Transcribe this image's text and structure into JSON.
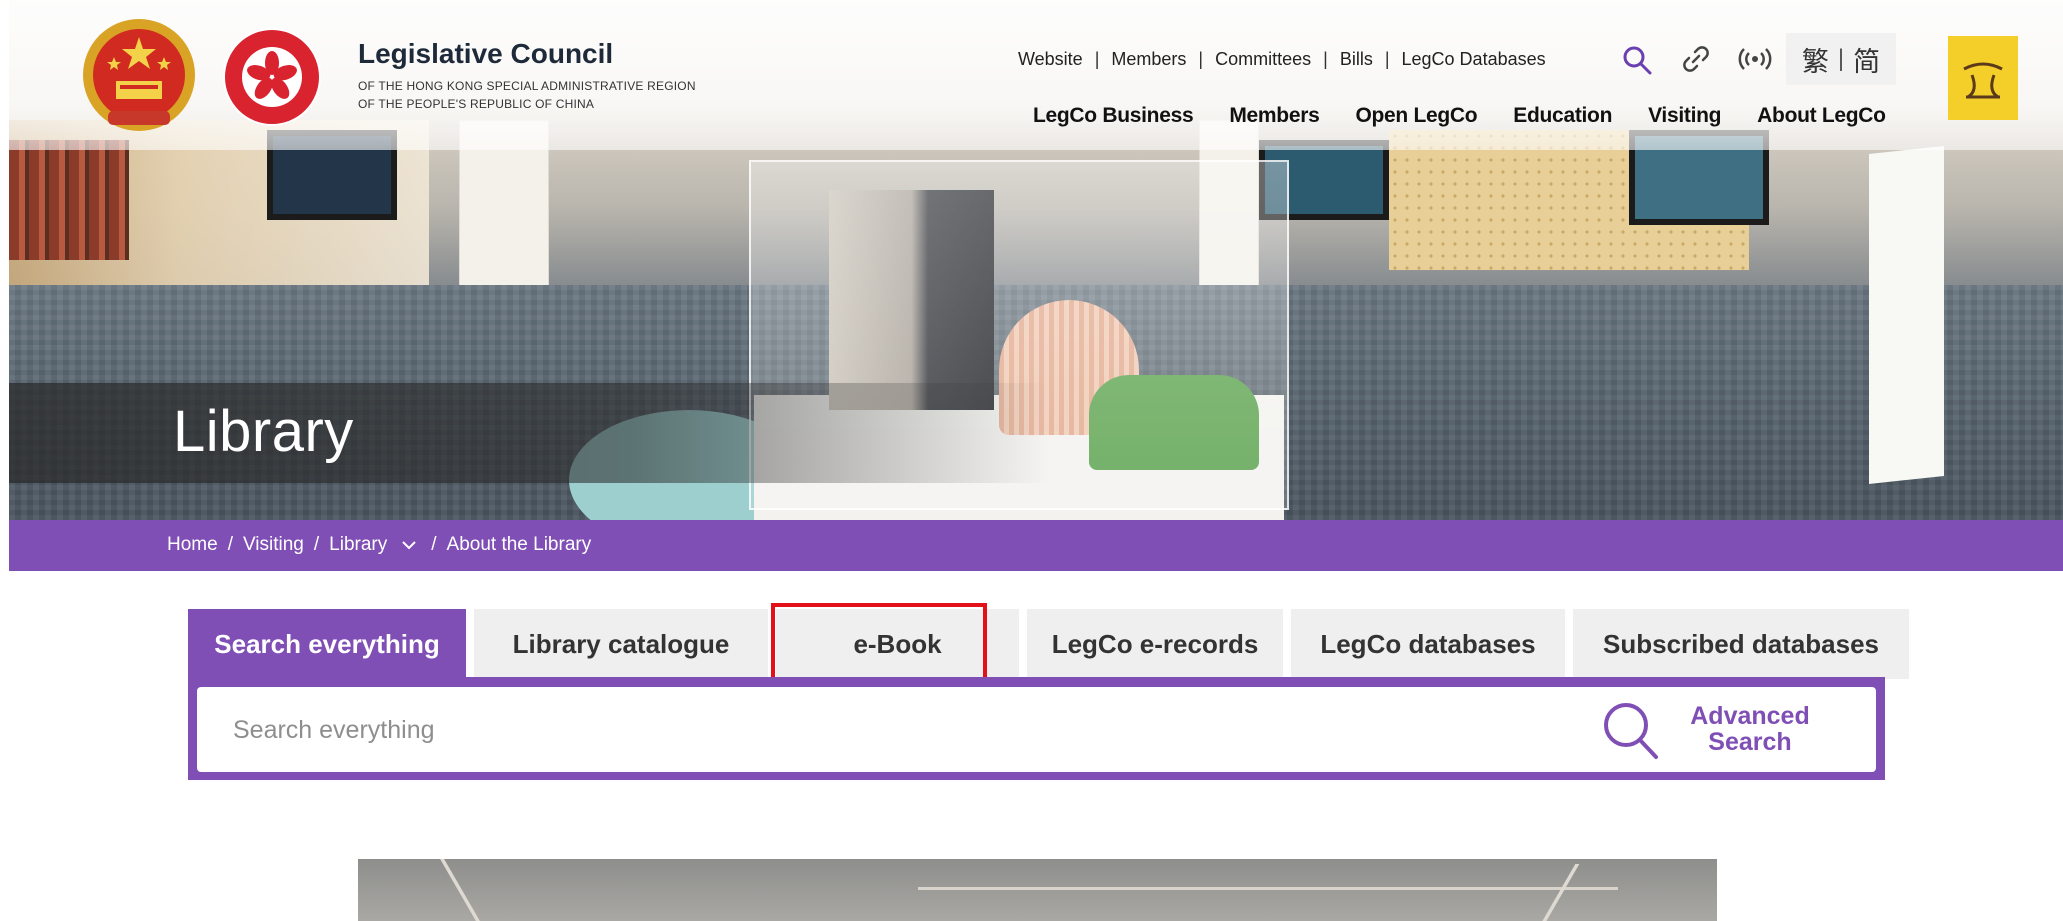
{
  "header": {
    "org_name": "Legislative Council",
    "org_sub1": "OF THE HONG KONG SPECIAL ADMINISTRATIVE REGION",
    "org_sub2": "OF THE PEOPLE'S REPUBLIC OF CHINA",
    "top_links": [
      "Website",
      "Members",
      "Committees",
      "Bills",
      "LegCo Databases"
    ],
    "lang_traditional": "繁",
    "lang_simplified": "简",
    "main_nav": [
      "LegCo Business",
      "Members",
      "Open LegCo",
      "Education",
      "Visiting",
      "About LegCo"
    ]
  },
  "hero": {
    "title": "Library"
  },
  "breadcrumb": {
    "items": [
      "Home",
      "Visiting",
      "Library",
      "About the Library"
    ]
  },
  "search": {
    "tabs": [
      {
        "label": "Search everything",
        "active": true
      },
      {
        "label": "Library catalogue",
        "active": false
      },
      {
        "label": "e-Book",
        "active": false
      },
      {
        "label": "LegCo e-records",
        "active": false
      },
      {
        "label": "LegCo databases",
        "active": false
      },
      {
        "label": "Subscribed databases",
        "active": false
      }
    ],
    "placeholder": "Search everything",
    "advanced_line1": "Advanced",
    "advanced_line2": "Search"
  },
  "colors": {
    "accent_purple": "#7f4fb5",
    "highlight_red": "#e3101a",
    "badge_yellow": "#f4cf2a"
  },
  "icons": [
    "search-icon",
    "link-icon",
    "broadcast-icon",
    "legco-logo-icon",
    "chevron-down-icon",
    "prc-emblem-icon",
    "hksar-emblem-icon"
  ]
}
